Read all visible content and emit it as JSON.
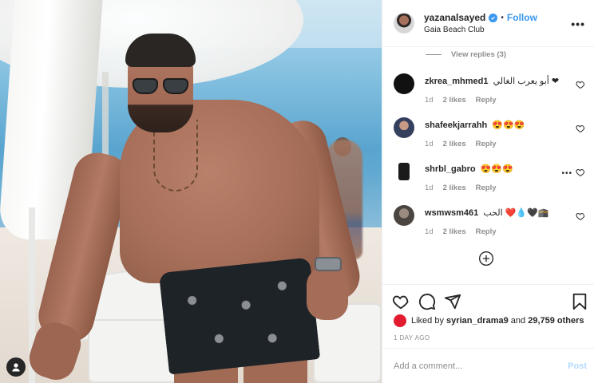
{
  "post": {
    "author": "yazanalsayed",
    "verified": true,
    "dot": "•",
    "follow_label": "Follow",
    "location": "Gaia Beach Club",
    "more_label": "•••"
  },
  "comments": {
    "view_replies": "View replies (3)",
    "items": [
      {
        "username": "zkrea_mhmed1",
        "text": "أبو يعرب الغالي ❤",
        "age": "1d",
        "likes": "2 likes",
        "reply": "Reply",
        "avatar_color": "#111111",
        "show_more": false
      },
      {
        "username": "shafeekjarrahh",
        "text": "😍😍😍",
        "age": "1d",
        "likes": "2 likes",
        "reply": "Reply",
        "avatar_color": "#4b5a86",
        "show_more": false
      },
      {
        "username": "shrbl_gabro",
        "text": "😍😍😍",
        "age": "1d",
        "likes": "2 likes",
        "reply": "Reply",
        "avatar_color": "#1b1b1b",
        "show_more": true
      },
      {
        "username": "wsmwsm461",
        "text": "الحب ❤️💧🖤🕋",
        "age": "1d",
        "likes": "2 likes",
        "reply": "Reply",
        "avatar_color": "#5a5550",
        "show_more": false
      }
    ],
    "more_icon": "add-circle-icon"
  },
  "likes": {
    "prefix": "Liked by",
    "user": "syrian_drama9",
    "middle": "and",
    "count": "29,759 others"
  },
  "timestamp": "1 DAY AGO",
  "add_comment": {
    "placeholder": "Add a comment...",
    "post_label": "Post"
  },
  "colors": {
    "accent": "#3897f0",
    "text": "#262626",
    "muted": "#8e8e8e",
    "post_disabled": "#b3dbff"
  }
}
